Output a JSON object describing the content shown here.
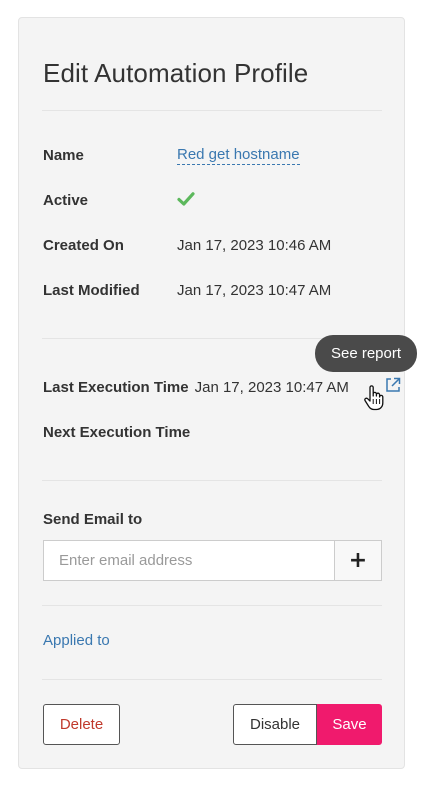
{
  "title": "Edit Automation Profile",
  "fields": {
    "name_label": "Name",
    "name_value": "Red get hostname",
    "active_label": "Active",
    "active_value": "check-icon",
    "created_label": "Created On",
    "created_value": "Jan 17, 2023 10:46 AM",
    "modified_label": "Last Modified",
    "modified_value": "Jan 17, 2023 10:47 AM"
  },
  "execution": {
    "last_label": "Last Execution Time",
    "last_value": "Jan 17, 2023 10:47 AM",
    "next_label": "Next Execution Time",
    "report_icon": "external-link-icon",
    "tooltip": "See report"
  },
  "email": {
    "label": "Send Email to",
    "placeholder": "Enter email address",
    "value": "",
    "add_icon": "plus-icon"
  },
  "applied_to_label": "Applied to",
  "buttons": {
    "delete": "Delete",
    "disable": "Disable",
    "save": "Save"
  },
  "colors": {
    "link": "#3a78b0",
    "check": "#5cb85c",
    "save_bg": "#f01a6d",
    "delete_text": "#c0392b",
    "tooltip_bg": "#4a4a4a"
  }
}
